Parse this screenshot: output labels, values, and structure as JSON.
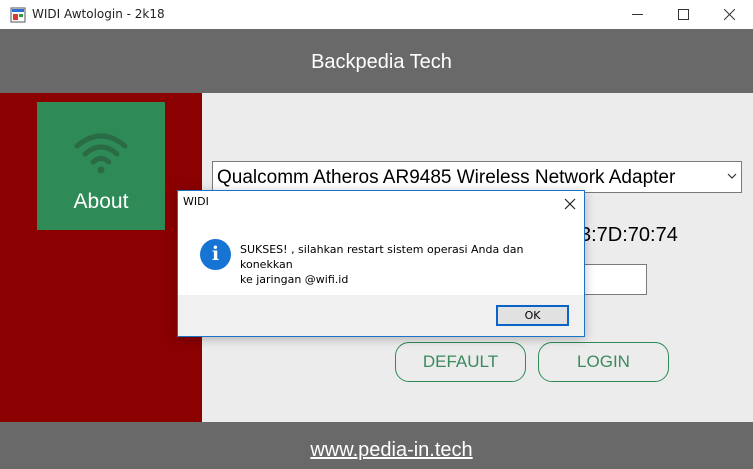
{
  "window": {
    "title": "WIDI Awtologin - 2k18",
    "app_icon": "window-app-icon",
    "controls": [
      "minimize-icon",
      "maximize-icon",
      "close-icon"
    ]
  },
  "header": {
    "title": "Backpedia Tech"
  },
  "sidebar": {
    "about_label": "About",
    "icon": "wifi-icon"
  },
  "main": {
    "adapter_selected": "Qualcomm Atheros AR9485 Wireless Network Adapter",
    "mac_partial": "3:7D:70:74",
    "buttons": {
      "default_label": "DEFAULT",
      "login_label": "LOGIN"
    }
  },
  "footer": {
    "link": "www.pedia-in.tech"
  },
  "dialog": {
    "title": "WIDI",
    "icon": "info-icon",
    "info_glyph": "i",
    "message_line1": "SUKSES! , silahkan restart sistem operasi Anda dan konekkan",
    "message_line2": "ke jaringan @wifi.id",
    "ok_label": "OK"
  },
  "colors": {
    "header_gray": "#696969",
    "sidebar_red": "#8b0000",
    "tile_green": "#2e8b57",
    "info_blue": "#1574d4"
  }
}
